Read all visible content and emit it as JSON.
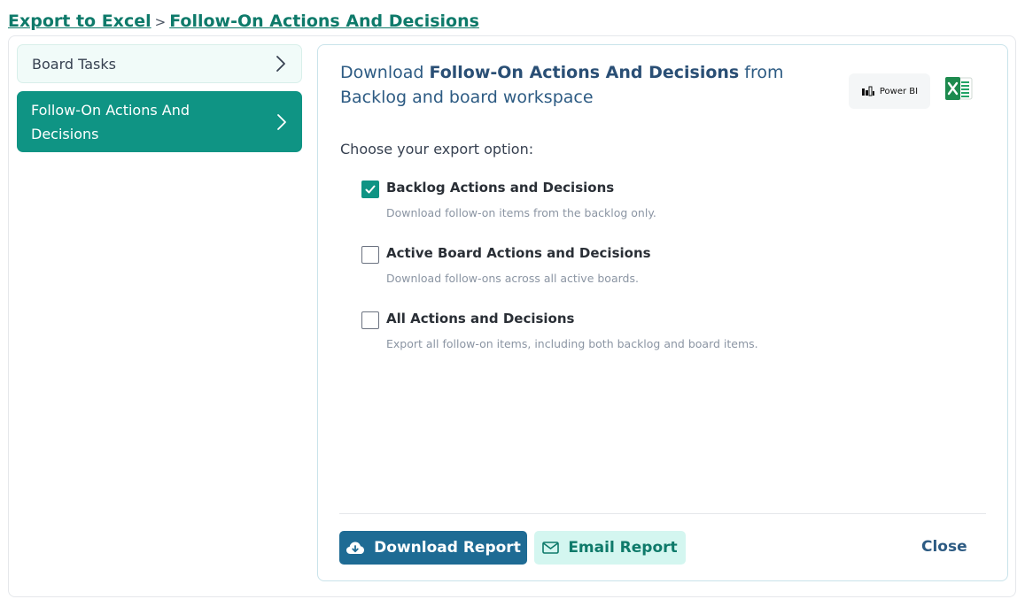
{
  "breadcrumb": {
    "root": "Export to Excel",
    "separator": ">",
    "current": "Follow-On Actions And Decisions"
  },
  "sidebar": {
    "items": [
      {
        "label": "Board Tasks",
        "active": false,
        "icon": "chevron-right-icon"
      },
      {
        "label": "Follow-On Actions And Decisions",
        "active": true,
        "icon": "chevron-right-icon"
      }
    ]
  },
  "panel": {
    "heading_prefix": "Download",
    "heading_bold": "Follow-On Actions And Decisions",
    "heading_suffix": "from Backlog and board workspace",
    "powerbi_label": "Power BI",
    "excel_icon": "excel-icon",
    "choose_label": "Choose your export option:",
    "options": [
      {
        "title": "Backlog Actions and Decisions",
        "desc": "Download follow-on items from the backlog only.",
        "checked": true
      },
      {
        "title": "Active Board Actions and Decisions",
        "desc": "Download follow-ons across all active boards.",
        "checked": false
      },
      {
        "title": "All Actions and Decisions",
        "desc": "Export all follow-on items, including both backlog and board items.",
        "checked": false
      }
    ]
  },
  "footer": {
    "download_label": "Download Report",
    "download_icon": "cloud-download-icon",
    "email_label": "Email Report",
    "email_icon": "envelope-icon",
    "close_label": "Close"
  },
  "colors": {
    "accent": "#0f9484",
    "primary_button": "#1e6b94",
    "secondary_button": "#d4f6f0",
    "heading_text": "#2d5b83"
  }
}
